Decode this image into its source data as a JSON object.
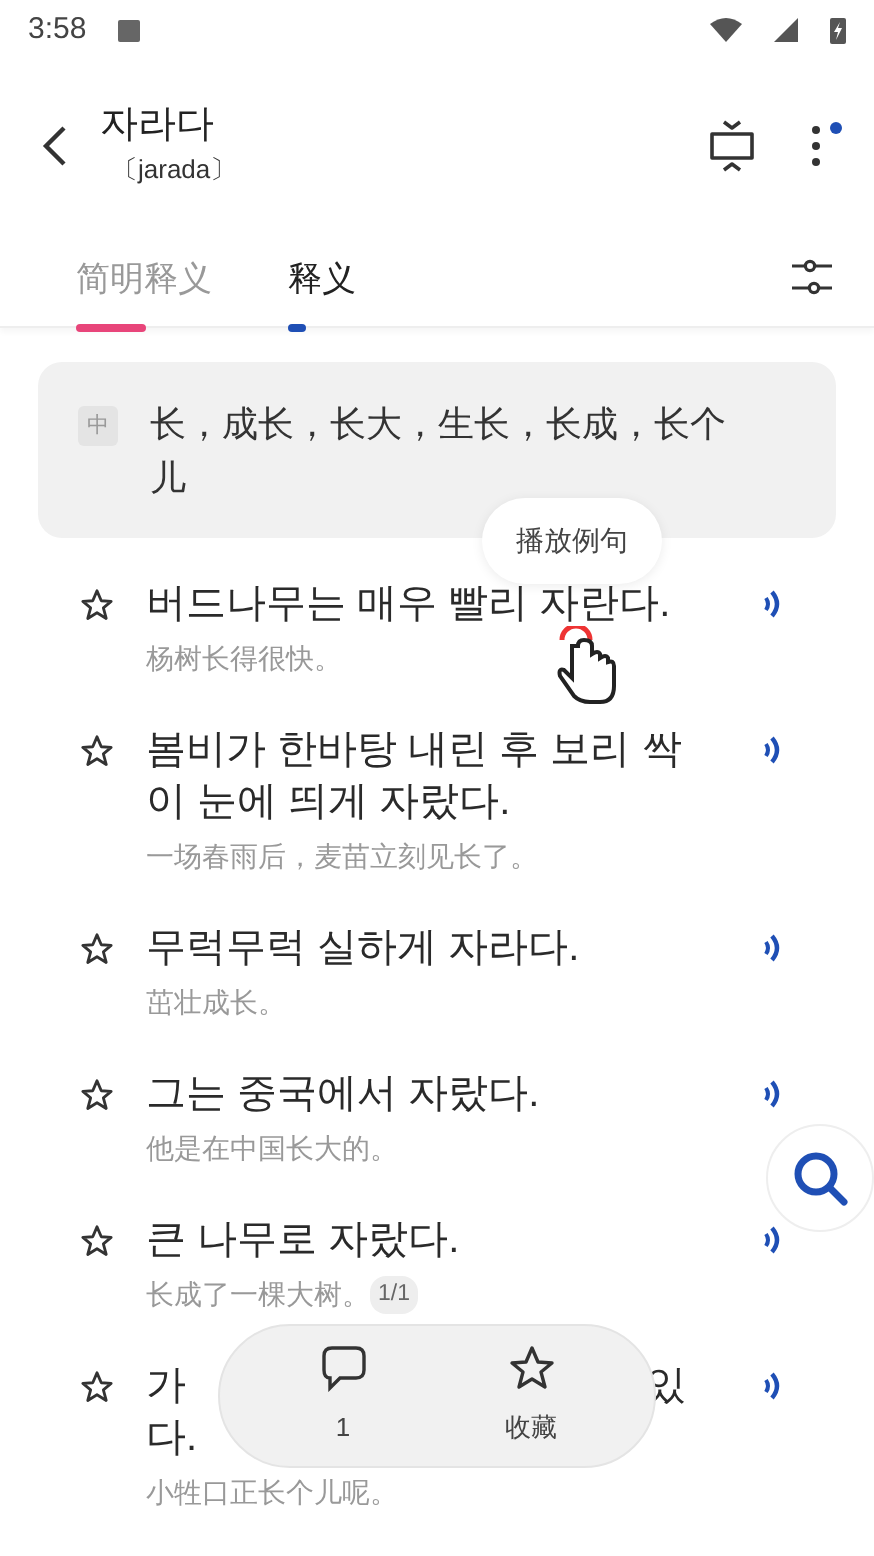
{
  "status_bar": {
    "time": "3:58"
  },
  "header": {
    "word": "자라다",
    "romanization": "〔jarada〕",
    "menu_badge": true
  },
  "tabs": [
    {
      "label": "简明释义",
      "selected": false,
      "color": "#e8457a"
    },
    {
      "label": "释义",
      "selected": true,
      "color": "#1f4fb5"
    }
  ],
  "definition": {
    "tag": "中",
    "text": "长，成长，长大，生长，长成，长个儿"
  },
  "tooltip": "播放例句",
  "examples": [
    {
      "korean": "버드나무는 매우 빨리 자란다.",
      "chinese": "杨树长得很快。"
    },
    {
      "korean": "봄비가 한바탕 내린 후 보리 싹이 눈에 띄게 자랐다.",
      "chinese": "一场春雨后，麦苗立刻见长了。"
    },
    {
      "korean": "무럭무럭 실하게 자라다.",
      "chinese": "茁壮成长。"
    },
    {
      "korean": "그는 중국에서 자랐다.",
      "chinese": "他是在中国长大的。"
    },
    {
      "korean": "큰 나무로 자랐다.",
      "chinese": "长成了一棵大树。",
      "badge": "1/1"
    },
    {
      "korean_start": "가",
      "korean_end": "있",
      "korean_line2": "다.",
      "chinese": "小牲口正长个儿呢。"
    }
  ],
  "action_bar": {
    "comment_count": "1",
    "favorite_label": "收藏"
  }
}
